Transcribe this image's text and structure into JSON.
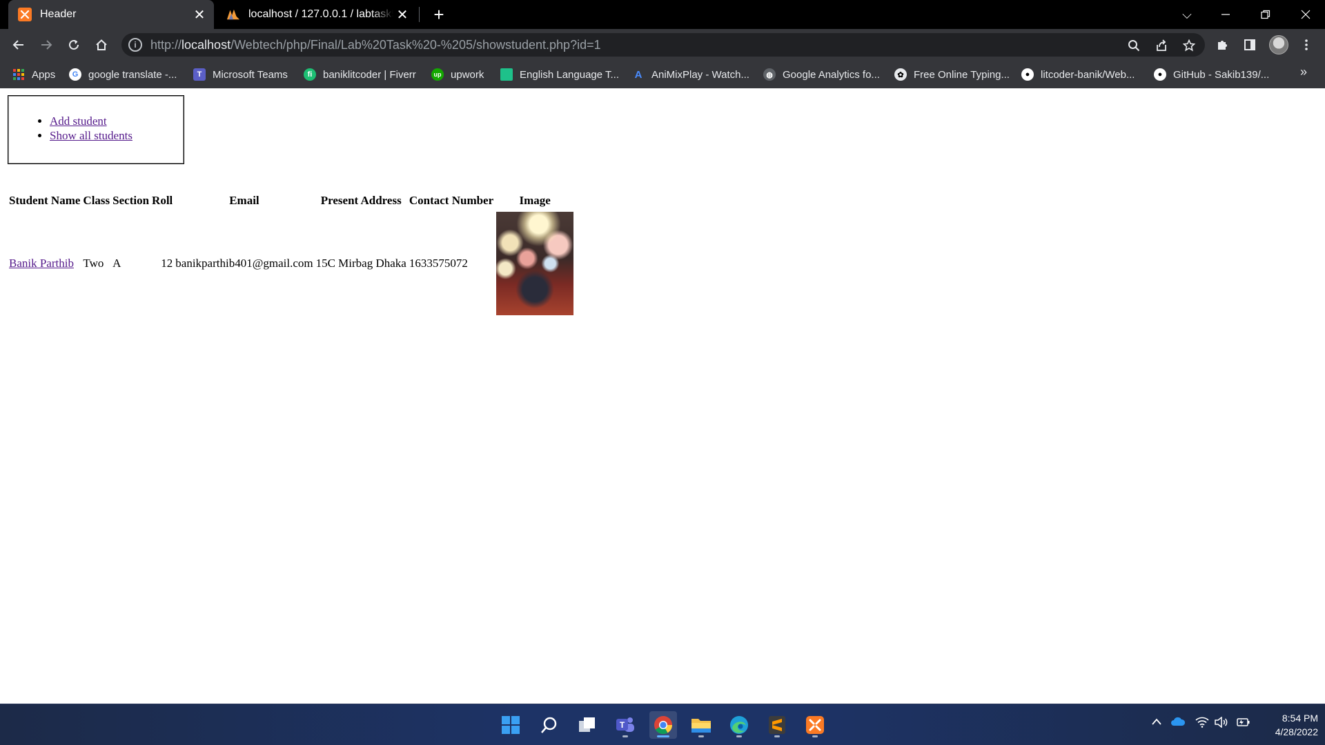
{
  "browser": {
    "tabs": [
      {
        "title": "Header",
        "active": true
      },
      {
        "title": "localhost / 127.0.0.1 / labtask5 / ",
        "active": false
      }
    ],
    "url_prefix": "http://",
    "url_host": "localhost",
    "url_path": "/Webtech/php/Final/Lab%20Task%20-%205/showstudent.php?id=1",
    "bookmarks": [
      {
        "label": "Apps",
        "icon": "apps-grid-icon"
      },
      {
        "label": "google translate -...",
        "icon": "google-icon"
      },
      {
        "label": "Microsoft Teams",
        "icon": "teams-icon"
      },
      {
        "label": "baniklitcoder | Fiverr",
        "icon": "fiverr-icon"
      },
      {
        "label": "upwork",
        "icon": "upwork-icon"
      },
      {
        "label": "English Language T...",
        "icon": "bookmark-green-icon"
      },
      {
        "label": "AniMixPlay - Watch...",
        "icon": "animixplay-icon"
      },
      {
        "label": "Google Analytics fo...",
        "icon": "globe-icon"
      },
      {
        "label": "Free Online Typing...",
        "icon": "paw-icon"
      },
      {
        "label": "litcoder-banik/Web...",
        "icon": "github-icon"
      },
      {
        "label": "GitHub - Sakib139/...",
        "icon": "github-icon"
      }
    ]
  },
  "nav": {
    "links": [
      {
        "label": "Add student"
      },
      {
        "label": "Show all students"
      }
    ]
  },
  "table": {
    "headers": [
      "Student Name",
      "Class",
      "Section",
      "Roll",
      "Email",
      "Present Address",
      "Contact Number",
      "Image"
    ],
    "rows": [
      {
        "name": "Banik Parthib",
        "class": "Two",
        "section": "A",
        "roll": "12",
        "email": "banikparthib401@gmail.com",
        "address": "15C Mirbag Dhaka",
        "contact": "1633575072"
      }
    ]
  },
  "taskbar": {
    "time": "8:54 PM",
    "date": "4/28/2022"
  },
  "colors": {
    "link": "#551a8b",
    "chrome_dark": "#35363a",
    "tab_bg": "#000000",
    "xampp_orange": "#fb7a24"
  }
}
